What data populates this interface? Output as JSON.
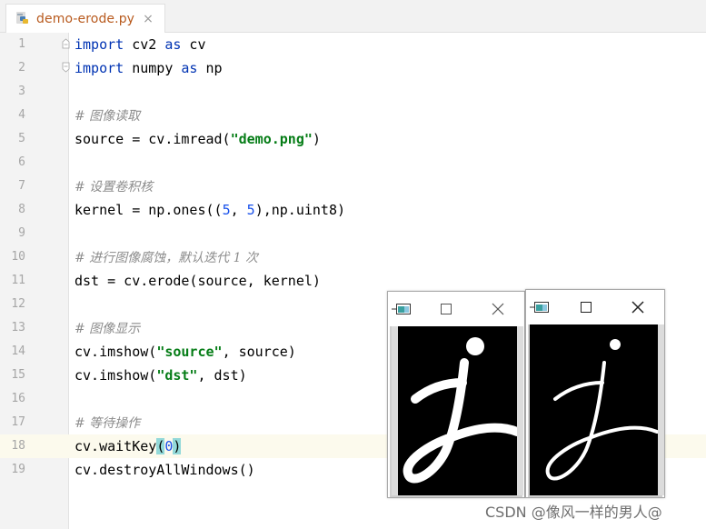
{
  "tab": {
    "filename": "demo-erode.py",
    "close_glyph": "×",
    "icon": "python-file-icon"
  },
  "editor": {
    "current_line": 18,
    "lines": [
      {
        "n": "1",
        "tokens": [
          {
            "t": "import",
            "c": "kw"
          },
          {
            "t": " cv2 "
          },
          {
            "t": "as",
            "c": "kw"
          },
          {
            "t": " cv"
          }
        ]
      },
      {
        "n": "2",
        "tokens": [
          {
            "t": "import",
            "c": "kw"
          },
          {
            "t": " numpy "
          },
          {
            "t": "as",
            "c": "kw"
          },
          {
            "t": " np"
          }
        ]
      },
      {
        "n": "3",
        "tokens": []
      },
      {
        "n": "4",
        "tokens": [
          {
            "t": "# 图像读取",
            "c": "cmt"
          }
        ]
      },
      {
        "n": "5",
        "tokens": [
          {
            "t": "source = cv.imread("
          },
          {
            "t": "\"demo.png\"",
            "c": "str"
          },
          {
            "t": ")"
          }
        ]
      },
      {
        "n": "6",
        "tokens": []
      },
      {
        "n": "7",
        "tokens": [
          {
            "t": "# 设置卷积核",
            "c": "cmt"
          }
        ]
      },
      {
        "n": "8",
        "tokens": [
          {
            "t": "kernel = np.ones(("
          },
          {
            "t": "5",
            "c": "num"
          },
          {
            "t": ", "
          },
          {
            "t": "5",
            "c": "num"
          },
          {
            "t": "),np.uint8)"
          }
        ]
      },
      {
        "n": "9",
        "tokens": []
      },
      {
        "n": "10",
        "tokens": [
          {
            "t": "# 进行图像腐蚀，默认迭代 1 次",
            "c": "cmt"
          }
        ]
      },
      {
        "n": "11",
        "tokens": [
          {
            "t": "dst = cv.erode(source, kernel)"
          }
        ]
      },
      {
        "n": "12",
        "tokens": []
      },
      {
        "n": "13",
        "tokens": [
          {
            "t": "# 图像显示",
            "c": "cmt"
          }
        ]
      },
      {
        "n": "14",
        "tokens": [
          {
            "t": "cv.imshow("
          },
          {
            "t": "\"source\"",
            "c": "str"
          },
          {
            "t": ", source)"
          }
        ]
      },
      {
        "n": "15",
        "tokens": [
          {
            "t": "cv.imshow("
          },
          {
            "t": "\"dst\"",
            "c": "str"
          },
          {
            "t": ", dst)"
          }
        ]
      },
      {
        "n": "16",
        "tokens": []
      },
      {
        "n": "17",
        "tokens": [
          {
            "t": "# 等待操作",
            "c": "cmt"
          }
        ]
      },
      {
        "n": "18",
        "tokens": [
          {
            "t": "cv.waitKey"
          },
          {
            "t": "(",
            "c": "paren-hl"
          },
          {
            "t": "0",
            "c": "num"
          },
          {
            "t": ")",
            "c": "paren-hl"
          }
        ]
      },
      {
        "n": "19",
        "tokens": [
          {
            "t": "cv.destroyAllWindows()"
          }
        ]
      }
    ]
  },
  "windows": [
    {
      "id": "source",
      "icon": "opencv-window-icon",
      "max_glyph": "maximize-icon",
      "close_glyph": "close-icon"
    },
    {
      "id": "dst",
      "icon": "opencv-window-icon",
      "max_glyph": "maximize-icon",
      "close_glyph": "close-icon"
    }
  ],
  "watermark": "CSDN @像风一样的男人@",
  "colors": {
    "keyword": "#0033b3",
    "string": "#067d17",
    "number": "#1750eb",
    "comment": "#8c8c8c",
    "tab_label": "#b85a1e",
    "current_line_bg": "#fcfaed",
    "paren_highlight": "#93d9d9"
  }
}
